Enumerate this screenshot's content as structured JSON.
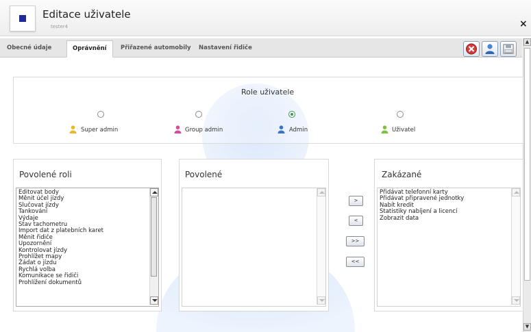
{
  "dialog": {
    "title": "Editace uživatele",
    "subtitle": "tester4",
    "close": "×"
  },
  "tabs": [
    {
      "label": "Obecné údaje",
      "active": false
    },
    {
      "label": "Oprávnění",
      "active": true
    },
    {
      "label": "Přiřazené automobily",
      "active": false
    },
    {
      "label": "Nastavení řidiče",
      "active": false
    }
  ],
  "toolbar": {
    "cancel_icon": "cancel-icon",
    "user_icon": "user-icon",
    "save_icon": "save-icon"
  },
  "roles": {
    "heading": "Role uživatele",
    "options": [
      {
        "label": "Super admin",
        "checked": false,
        "color": "#e8b830"
      },
      {
        "label": "Group admin",
        "checked": false,
        "color": "#d64aa0"
      },
      {
        "label": "Admin",
        "checked": true,
        "color": "#3a72c8"
      },
      {
        "label": "Uživatel",
        "checked": false,
        "color": "#7cc23a"
      }
    ]
  },
  "allowed_roles": {
    "heading": "Povolené roli",
    "items": [
      "Editovat body",
      "Měnit účel jízdy",
      "Slučovat jízdy",
      "Tankování",
      "Výdaje",
      "Stav tachometru",
      "Import dat z platebních karet",
      "Měnit řidiče",
      "Upozornění",
      "Kontrolovat jízdy",
      "Prohlížet mapy",
      "Žádat o jízdu",
      "Rychlá volba",
      "Komunikace se řidiči",
      "Prohlížení dokumentů"
    ]
  },
  "allowed": {
    "heading": "Povolené",
    "items": []
  },
  "move_buttons": [
    ">",
    "<",
    ">>",
    "<<"
  ],
  "forbidden": {
    "heading": "Zakázané",
    "items": [
      "Přidávat telefonní karty",
      "Přidávat připravené jednotky",
      "Nabít kredit",
      "Statistiky nabíjení a licencí",
      "Zobrazit data"
    ]
  }
}
